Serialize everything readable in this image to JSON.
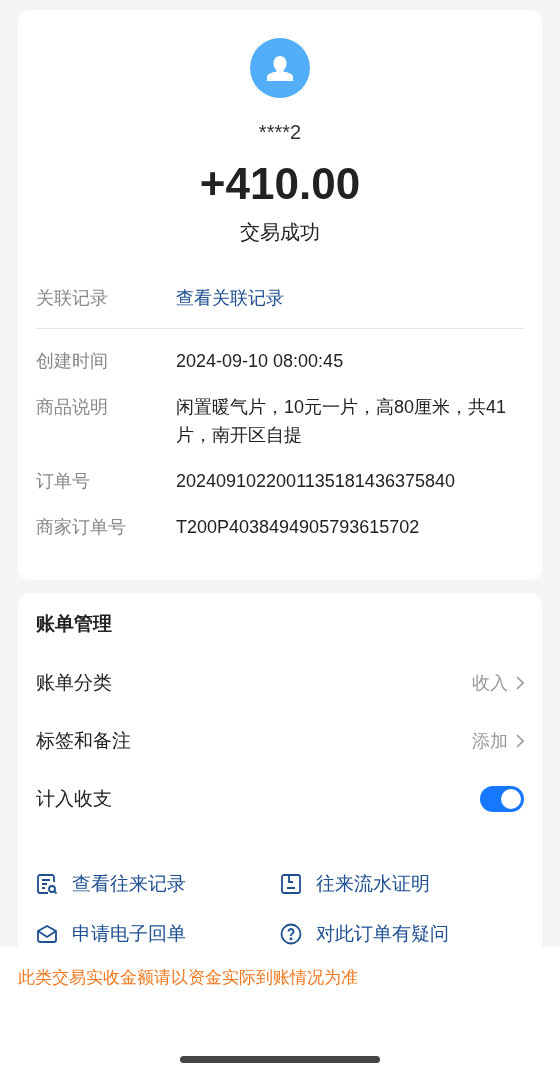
{
  "payer": {
    "name": "****2",
    "amount": "+410.00",
    "status": "交易成功"
  },
  "related": {
    "label": "关联记录",
    "link": "查看关联记录"
  },
  "details": [
    {
      "label": "创建时间",
      "value": "2024-09-10 08:00:45"
    },
    {
      "label": "商品说明",
      "value": "闲置暖气片，10元一片，高80厘米，共41片，南开区自提"
    },
    {
      "label": "订单号",
      "value": "2024091022001135181436375840"
    },
    {
      "label": "商家订单号",
      "value": "T200P4038494905793615702"
    }
  ],
  "bill_management": {
    "title": "账单管理",
    "rows": [
      {
        "kind": "link",
        "label": "账单分类",
        "value": "收入"
      },
      {
        "kind": "link",
        "label": "标签和备注",
        "value": "添加"
      },
      {
        "kind": "switch",
        "label": "计入收支",
        "on": true
      }
    ],
    "actions": [
      {
        "kind": "records",
        "label": "查看往来记录"
      },
      {
        "kind": "statement",
        "label": "往来流水证明"
      },
      {
        "kind": "receipt",
        "label": "申请电子回单"
      },
      {
        "kind": "question",
        "label": "对此订单有疑问"
      }
    ]
  },
  "notice": "此类交易实收金额请以资金实际到账情况为准"
}
